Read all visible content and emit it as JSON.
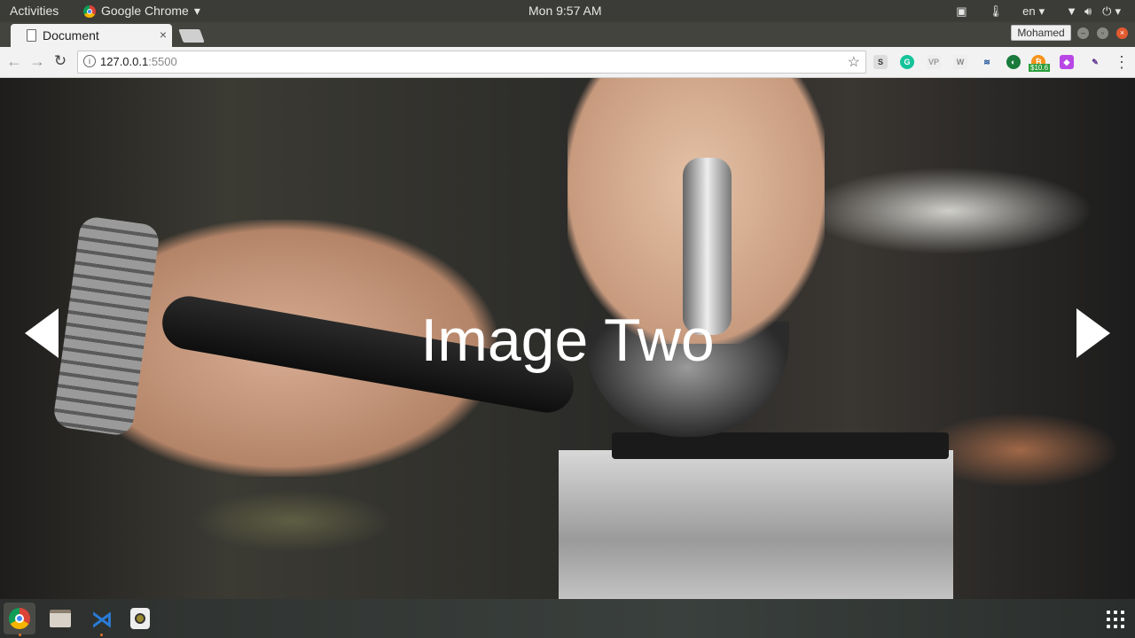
{
  "topbar": {
    "activities": "Activities",
    "app_name": "Google Chrome",
    "app_menu_arrow": "▾",
    "clock": "Mon  9:57 AM",
    "language": "en",
    "language_arrow": "▾",
    "power_arrow": "▾"
  },
  "browser": {
    "tab_title": "Document",
    "tab_close": "×",
    "profile_name": "Mohamed",
    "url_host": "127.0.0.1",
    "url_port": ":5500",
    "extension_badge": "$10.6"
  },
  "page": {
    "slide_caption": "Image Two"
  },
  "colors": {
    "topbar_bg": "#3b3b37",
    "tab_bg": "#f2f2f2",
    "close_button": "#e25a2f"
  }
}
